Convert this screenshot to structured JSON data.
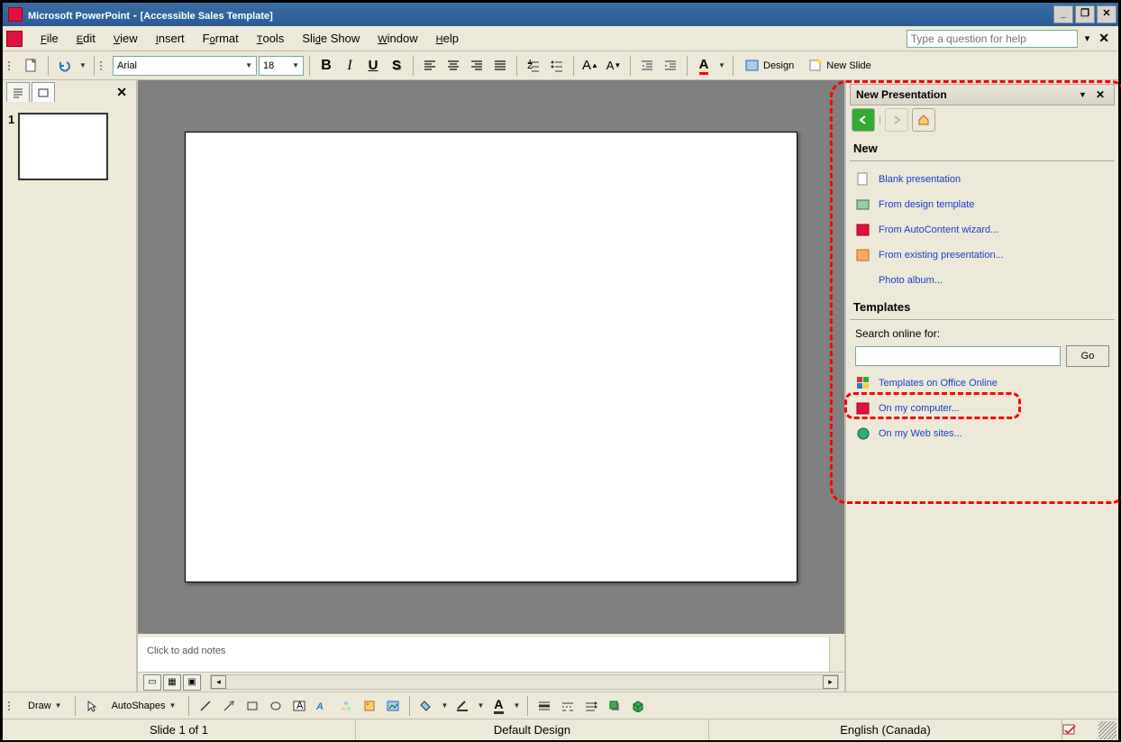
{
  "titlebar": {
    "app": "Microsoft PowerPoint",
    "doc": "[Accessible Sales Template]"
  },
  "menus": [
    "File",
    "Edit",
    "View",
    "Insert",
    "Format",
    "Tools",
    "Slide Show",
    "Window",
    "Help"
  ],
  "help_placeholder": "Type a question for help",
  "font": {
    "name": "Arial",
    "size": "18"
  },
  "toolbar_right": {
    "design": "Design",
    "new_slide": "New Slide"
  },
  "thumb_number": "1",
  "notes_placeholder": "Click to add notes",
  "drawbar": {
    "draw": "Draw",
    "autoshapes": "AutoShapes"
  },
  "status": {
    "slide": "Slide 1 of 1",
    "design": "Default Design",
    "lang": "English (Canada)"
  },
  "taskpane": {
    "title": "New Presentation",
    "sections": {
      "new": "New",
      "templates": "Templates"
    },
    "links": {
      "blank": "Blank presentation",
      "design_tpl": "From design template",
      "autocontent": "From AutoContent wizard...",
      "existing": "From existing presentation...",
      "photo": "Photo album...",
      "search_label": "Search online for:",
      "go": "Go",
      "office_online": "Templates on Office Online",
      "on_computer": "On my computer...",
      "web_sites": "On my Web sites..."
    }
  }
}
